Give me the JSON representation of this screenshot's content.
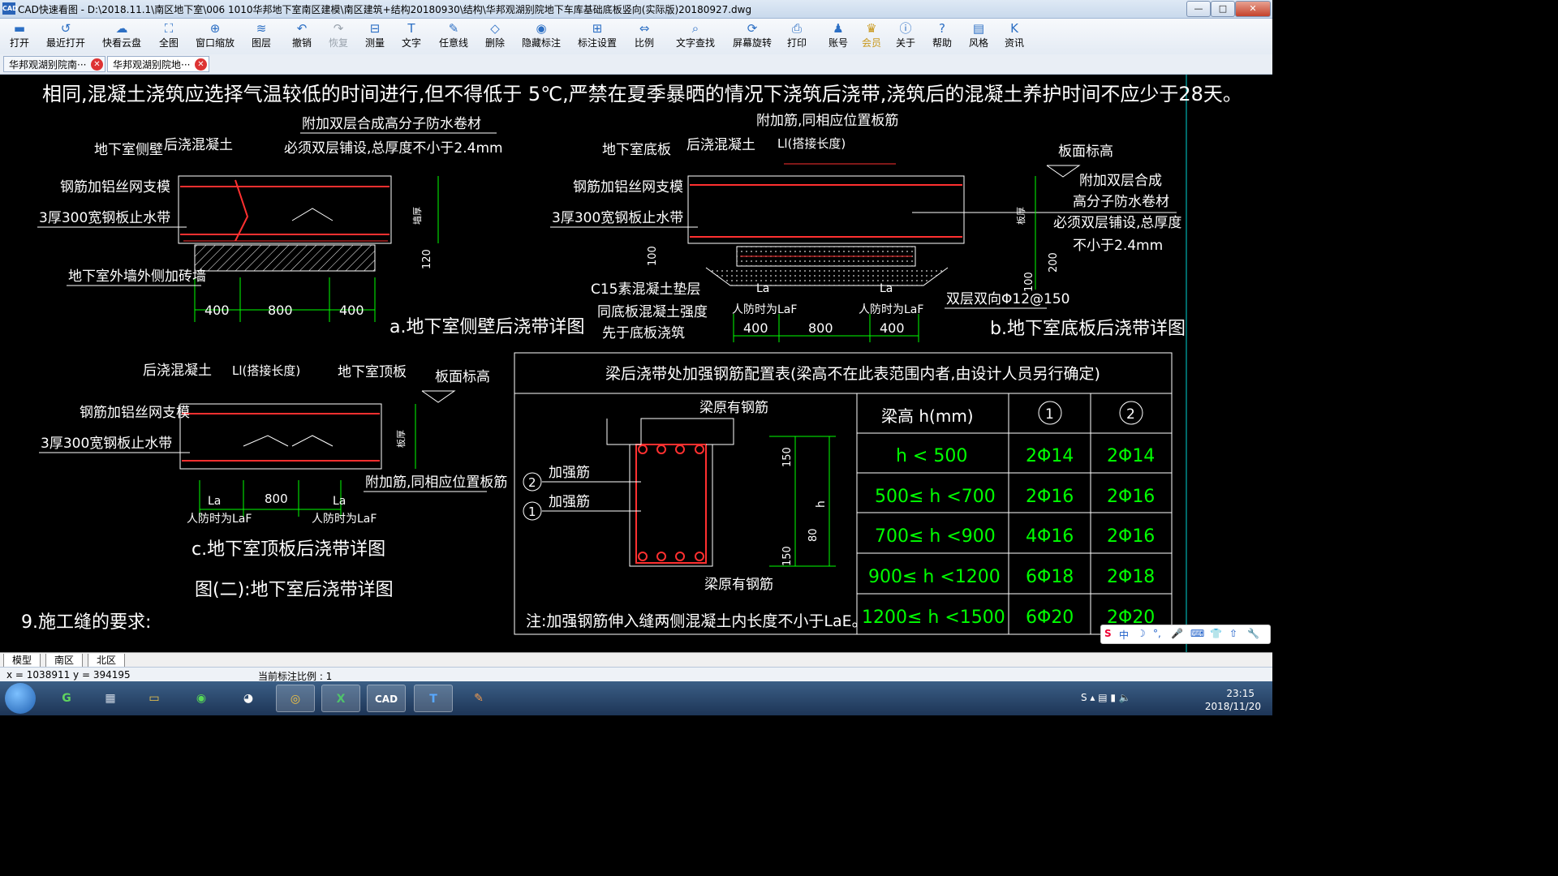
{
  "window": {
    "title": "CAD快速看图 - D:\\2018.11.1\\南区地下室\\006    1010华邦地下室南区建模\\南区建筑+结构20180930\\结构\\华邦观湖别院地下车库基础底板竖向(实际版)20180927.dwg",
    "app_icon": "CAD",
    "minimize": "—",
    "maximize": "□",
    "close": "✕"
  },
  "toolbar": {
    "items": [
      {
        "label": "打开",
        "icon": "folder-icon"
      },
      {
        "label": "最近打开",
        "icon": "history-icon"
      },
      {
        "label": "快看云盘",
        "icon": "cloud-icon"
      },
      {
        "label": "全图",
        "icon": "fullview-icon"
      },
      {
        "label": "窗口缩放",
        "icon": "zoom-window-icon"
      },
      {
        "label": "图层",
        "icon": "layers-icon"
      },
      {
        "label": "撤销",
        "icon": "undo-icon"
      },
      {
        "label": "恢复",
        "icon": "redo-icon"
      },
      {
        "label": "测量",
        "icon": "measure-icon"
      },
      {
        "label": "文字",
        "icon": "text-icon"
      },
      {
        "label": "任意线",
        "icon": "pen-icon"
      },
      {
        "label": "删除",
        "icon": "eraser-icon"
      },
      {
        "label": "隐藏标注",
        "icon": "eye-hide-icon"
      },
      {
        "label": "标注设置",
        "icon": "dim-settings-icon"
      },
      {
        "label": "比例",
        "icon": "scale-icon"
      },
      {
        "label": "文字查找",
        "icon": "text-search-icon"
      },
      {
        "label": "屏幕旋转",
        "icon": "rotate-icon"
      },
      {
        "label": "打印",
        "icon": "printer-icon"
      },
      {
        "label": "账号",
        "icon": "user-icon"
      },
      {
        "label": "会员",
        "icon": "vip-icon"
      },
      {
        "label": "关于",
        "icon": "info-icon"
      },
      {
        "label": "帮助",
        "icon": "help-icon"
      },
      {
        "label": "风格",
        "icon": "style-icon"
      },
      {
        "label": "资讯",
        "icon": "news-icon"
      }
    ]
  },
  "doc_tabs": [
    {
      "label": "华邦观湖别院南···",
      "close": "✕"
    },
    {
      "label": "华邦观湖别院地···",
      "close": "✕"
    }
  ],
  "drawing": {
    "top_note": "相同,混凝土浇筑应选择气温较低的时间进行,但不得低于 5℃,严禁在夏季暴晒的情况下浇筑后浇带,浇筑后的混凝土养护时间不应少于28天。",
    "detail_a": {
      "title": "a.地下室侧壁后浇带详图",
      "labels": [
        "地下室侧壁",
        "后浇混凝土",
        "附加双层合成高分子防水卷材",
        "必须双层铺设,总厚度不小于2.4mm",
        "钢筋加铝丝网支模",
        "3厚300宽钢板止水带",
        "地下室外墙外侧加砖墙",
        "墙厚",
        "120"
      ],
      "dims": [
        "400",
        "800",
        "400"
      ]
    },
    "detail_b": {
      "title": "b.地下室底板后浇带详图",
      "labels": [
        "附加筋,同相应位置板筋",
        "Ll(搭接长度)",
        "地下室底板",
        "后浇混凝土",
        "板面标高",
        "附加双层合成",
        "高分子防水卷材",
        "必须双层铺设,总厚度",
        "不小于2.4mm",
        "钢筋加铝丝网支模",
        "3厚300宽钢板止水带",
        "C15素混凝土垫层",
        "同底板混凝土强度",
        "先于底板浇筑",
        "La",
        "人防时为LaF",
        "双层双向Φ12@150",
        "板厚",
        "100",
        "200",
        "100"
      ],
      "dims": [
        "400",
        "800",
        "400"
      ]
    },
    "detail_c": {
      "title": "c.地下室顶板后浇带详图",
      "labels": [
        "后浇混凝土",
        "Ll(搭接长度)",
        "地下室顶板",
        "板面标高",
        "钢筋加铝丝网支模",
        "3厚300宽钢板止水带",
        "附加筋,同相应位置板筋",
        "板厚",
        "La",
        "人防时为LaF"
      ],
      "dims": [
        "800"
      ]
    },
    "figure_caption": "图(二):地下室后浇带详图",
    "section_heading": "9.施工缝的要求:",
    "table": {
      "title": "梁后浇带处加强钢筋配置表(梁高不在此表范围内者,由设计人员另行确定)",
      "header": [
        "梁高 h(mm)",
        "1",
        "2"
      ],
      "rows": [
        [
          "h < 500",
          "2Φ14",
          "2Φ14"
        ],
        [
          "500≤ h <700",
          "2Φ16",
          "2Φ16"
        ],
        [
          "700≤ h <900",
          "4Φ16",
          "2Φ16"
        ],
        [
          "900≤ h <1200",
          "6Φ18",
          "2Φ18"
        ],
        [
          "1200≤ h <1500",
          "6Φ20",
          "2Φ20"
        ]
      ],
      "beam_labels": [
        "梁原有钢筋",
        "加强筋",
        "加强筋",
        "梁原有钢筋",
        "150",
        "80",
        "150",
        "h",
        "2",
        "1"
      ],
      "note": "注:加强钢筋伸入缝两侧混凝土内长度不小于LaE。"
    }
  },
  "layout_tabs": [
    "模型",
    "南区",
    "北区"
  ],
  "status": {
    "coords": "x = 1038911  y = 394195",
    "scale": "当前标注比例 : 1"
  },
  "ime": {
    "items": [
      "S",
      "中",
      "☽",
      "°,",
      "🎤",
      "⌨",
      "👕",
      "⇧",
      "🔧"
    ]
  },
  "taskbar": {
    "apps": [
      {
        "name": "start",
        "label": ""
      },
      {
        "name": "browser-g",
        "label": "G"
      },
      {
        "name": "calculator",
        "label": "▦"
      },
      {
        "name": "explorer",
        "label": "▭"
      },
      {
        "name": "wechat",
        "label": "◉"
      },
      {
        "name": "qq",
        "label": "◕"
      },
      {
        "name": "chrome",
        "label": "◎"
      },
      {
        "name": "excel",
        "label": "X"
      },
      {
        "name": "cad",
        "label": "CAD"
      },
      {
        "name": "text-app",
        "label": "T"
      },
      {
        "name": "paint",
        "label": "✎"
      }
    ],
    "time": "23:15",
    "date": "2018/11/20"
  },
  "colors": {
    "canvas": "#000000",
    "white": "#ffffff",
    "red": "#ff3030",
    "green": "#00ff00",
    "cyan": "#00d5d5",
    "yellow": "#ffff00"
  }
}
